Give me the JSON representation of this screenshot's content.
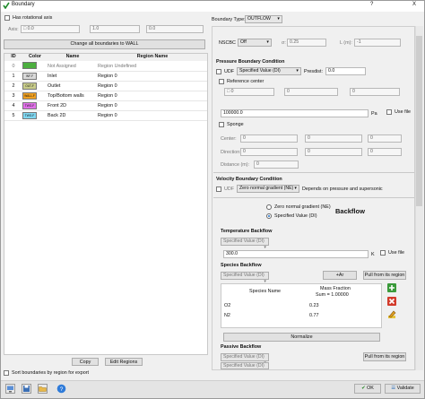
{
  "window": {
    "title": "Boundary",
    "help": "?",
    "close": "X"
  },
  "left": {
    "rotational_label": "Has rotational axis",
    "axis_label": "Axis:",
    "axis_values": [
      "0.0",
      "1.0",
      "0.0"
    ],
    "change_all_button": "Change all boundaries to WALL",
    "columns": [
      "ID",
      "Color",
      "Name",
      "Region Name"
    ],
    "rows": [
      {
        "id": "0",
        "color": "#4caf3f",
        "tag": "",
        "name": "Not Assigned",
        "region": "Region Undefined",
        "dim": true
      },
      {
        "id": "1",
        "color": "#d9d9d9",
        "tag": "INF-F",
        "name": "Inlet",
        "region": "Region 0",
        "dim": false
      },
      {
        "id": "2",
        "color": "#c8cc8a",
        "tag": "OUT-F",
        "name": "Outlet",
        "region": "Region 0",
        "dim": false
      },
      {
        "id": "3",
        "color": "#f0a020",
        "tag": "WALL-F",
        "name": "Top/Bottom walls",
        "region": "Region 0",
        "dim": false
      },
      {
        "id": "4",
        "color": "#e070e8",
        "tag": "TWO-F",
        "name": "Front 2D",
        "region": "Region 0",
        "dim": false
      },
      {
        "id": "5",
        "color": "#7fd6f0",
        "tag": "TWO-F",
        "name": "Back 2D",
        "region": "Region 0",
        "dim": false
      }
    ],
    "copy_button": "Copy",
    "edit_regions_button": "Edit Regions",
    "sort_label": "Sort boundaries by region for export"
  },
  "right": {
    "boundary_type_label": "Boundary Type:",
    "boundary_type_value": "OUTFLOW",
    "nscbc_label": "NSCBC",
    "nscbc_value": "Off",
    "sigma_label": "σ:",
    "sigma_value": "0.25",
    "l_label": "L (m):",
    "l_value": "-1",
    "pressure_title": "Pressure Boundary Condition",
    "udf_label": "UDF",
    "pressure_mode": "Specified Value (DI)",
    "presdist_label": "Presdist:",
    "presdist_value": "0.0",
    "reference_center_label": "Reference center",
    "ref_values": [
      "0",
      "0",
      "0"
    ],
    "pressure_value": "100000.0",
    "pressure_unit": "Pa",
    "use_file_label": "Use file",
    "sponge_label": "Sponge",
    "center_label": "Center:",
    "center_values": [
      "0",
      "0",
      "0"
    ],
    "direction_label": "Direction:",
    "direction_values": [
      "0",
      "0",
      "0"
    ],
    "distance_label": "Distance (m):",
    "distance_value": "0",
    "velocity_title": "Velocity Boundary Condition",
    "velocity_udf_label": "UDF",
    "velocity_mode": "Zero normal gradient (NE)",
    "velocity_note": "Depends on pressure and supersonic",
    "radio_zero": "Zero normal gradient (NE)",
    "radio_specified": "Specified Value (DI)",
    "backflow_label": "Backflow",
    "temp_title": "Temperature Backflow",
    "temp_mode": "Specified Value (DI)",
    "temp_value": "300.0",
    "temp_unit": "K",
    "temp_use_file": "Use file",
    "species_title": "Species Backflow",
    "species_mode": "Specified Value (DI)",
    "species_add_button": "+Ar",
    "species_pull_button": "Pull from its region",
    "species_col_name": "Species Name",
    "species_col_frac": "Mass Fraction",
    "species_sum": "Sum = 1.00000",
    "species_rows": [
      {
        "name": "O2",
        "frac": "0.23"
      },
      {
        "name": "N2",
        "frac": "0.77"
      }
    ],
    "normalize_button": "Normalize",
    "passive_title": "Passive Backflow",
    "passive_mode": "Specified Value (DI)",
    "passive_pull_button": "Pull from its region",
    "passive_mode2": "Specified Value (DI)"
  },
  "footer": {
    "ok": "OK",
    "validate": "Validate"
  }
}
